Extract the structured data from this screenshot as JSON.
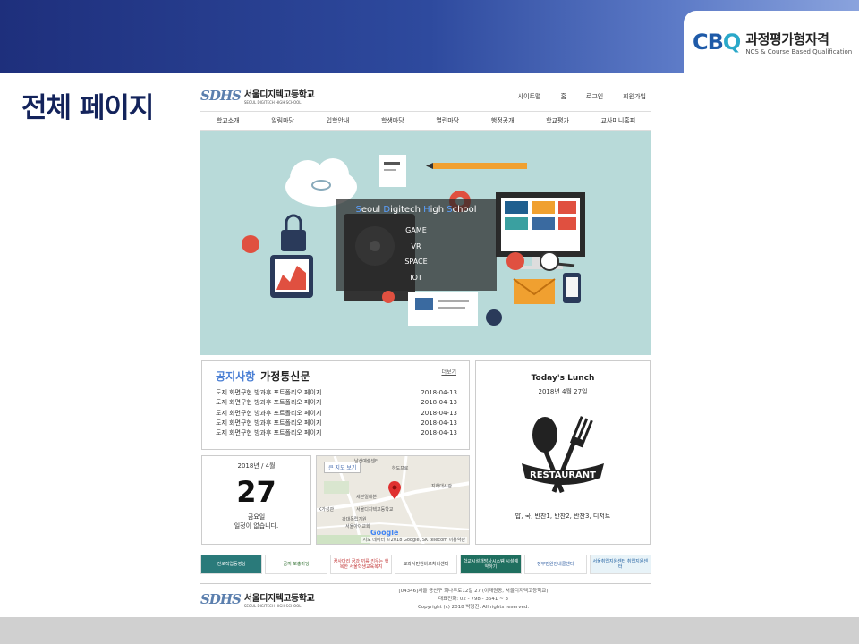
{
  "slide": {
    "title": "전체 페이지",
    "logo_mark_c": "CB",
    "logo_mark_q": "Q",
    "logo_title": "과정평가형자격",
    "logo_subtitle": "NCS & Course Based Qualification"
  },
  "site": {
    "logo_mark": "SDHS",
    "name": "서울디지텍고등학교",
    "name_en": "SEOUL DIGITECH HIGH SCHOOL",
    "util_links": [
      "사이트맵",
      "홈",
      "로그인",
      "회원가입"
    ],
    "nav": [
      "학교소개",
      "알림마당",
      "입학안내",
      "학생마당",
      "열린마당",
      "행정공개",
      "학교평가",
      "교사미니홈피"
    ],
    "hero": {
      "title_parts": [
        "S",
        "eoul ",
        "D",
        "igitech ",
        "H",
        "igh ",
        "S",
        "chool"
      ],
      "items": [
        "GAME",
        "VR",
        "SPACE",
        "IOT"
      ]
    },
    "notice": {
      "tab_notice": "공지사항",
      "tab_newsletter": "가정통신문",
      "more": "더보기",
      "rows": [
        {
          "title": "도제 화면구현 방과후 포트폴리오 페이지",
          "date": "2018-04-13"
        },
        {
          "title": "도제 화면구현 방과후 포트폴리오 페이지",
          "date": "2018-04-13"
        },
        {
          "title": "도제 화면구현 방과후 포트폴리오 페이지",
          "date": "2018-04-13"
        },
        {
          "title": "도제 화면구현 방과후 포트폴리오 페이지",
          "date": "2018-04-13"
        },
        {
          "title": "도제 화면구현 방과후 포트폴리오 페이지",
          "date": "2018-04-13"
        }
      ]
    },
    "lunch": {
      "title": "Today's Lunch",
      "date": "2018년 4월 27일",
      "badge": "RESTAURANT",
      "menu": "밥, 국, 반찬1, 반찬2, 반찬3, 디저트"
    },
    "calendar": {
      "year_month": "2018년 / 4월",
      "day": "27",
      "weekday": "금요일",
      "note": "일정이 없습니다."
    },
    "map": {
      "button": "큰 지도 보기",
      "labels": [
        "남산예술센터",
        "지하대사관",
        "세븐일레븐",
        "K가성관",
        "서울디지텍고등학교",
        "강대독립기원",
        "서울아이교회",
        "하도프로"
      ],
      "google": "Google",
      "attribution": "지도 데이터 ©2018 Google, SK telecom   이용약관"
    },
    "banners": [
      {
        "text": "진로직업동영상",
        "bg": "#2a7a7a",
        "fg": "#ffffff"
      },
      {
        "text": "꿈끼 보충마당",
        "bg": "#ffffff",
        "fg": "#2a6b2a"
      },
      {
        "text": "꿈사다리 꿈과 끼를 키우는 행복한 서울학생교육복지",
        "bg": "#ffffff",
        "fg": "#c03030"
      },
      {
        "text": "교과서민원바로처리센터",
        "bg": "#ffffff",
        "fg": "#333333"
      },
      {
        "text": "학교시설개방사시스템 시설예약하기",
        "bg": "#1f6f5f",
        "fg": "#ffffff"
      },
      {
        "text": "정부민원안내콜센터",
        "bg": "#ffffff",
        "fg": "#2a5aa0"
      },
      {
        "text": "서울취업지원센터 취업지원센터",
        "bg": "#e8f3f8",
        "fg": "#1f5fa0"
      }
    ],
    "footer": {
      "address": "[04346]서울 용산구 회나무로12길 27 (이태원동, 서울디지텍고등학교)",
      "phone": "대표전화: 02 - 798 - 3641 ~ 3",
      "copyright": "Copyright (c) 2018 박형진. All rights reserved."
    }
  },
  "colors": {
    "hero_bg": "#b8dad9",
    "accent_blue": "#4a7fd4",
    "title_navy": "#13235b"
  }
}
